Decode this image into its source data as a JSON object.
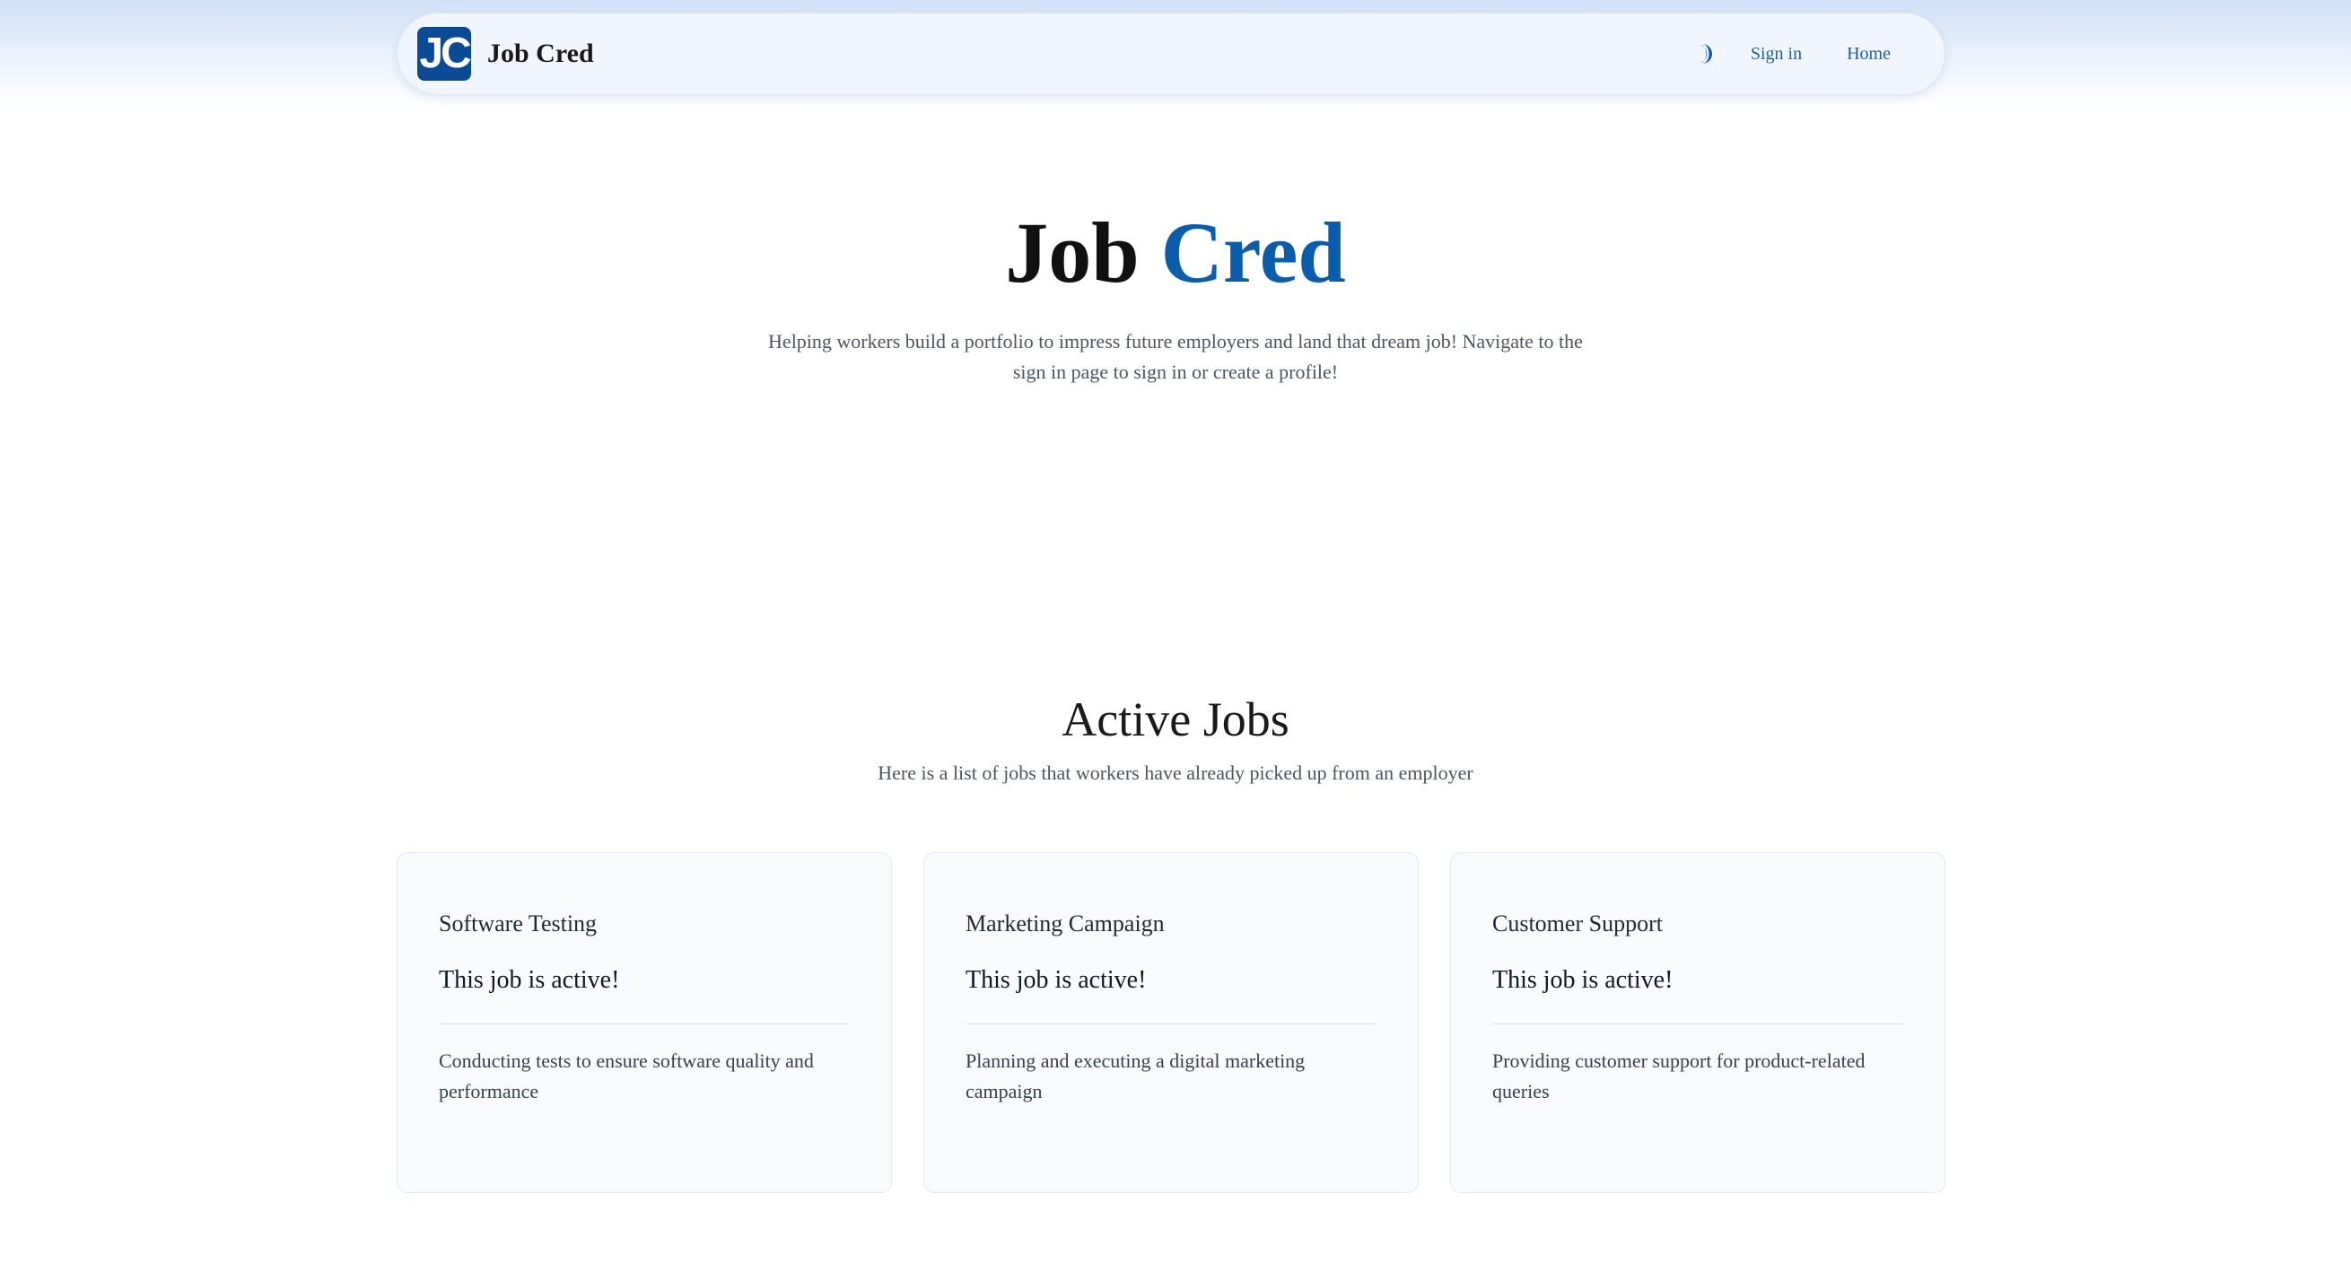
{
  "header": {
    "logo_text": "JC",
    "brand_name": "Job Cred",
    "theme_toggle_icon": "half-moon-icon",
    "nav_links": [
      {
        "label": "Sign in"
      },
      {
        "label": "Home"
      }
    ]
  },
  "hero": {
    "title_part1": "Job",
    "title_part2": "Cred",
    "description": "Helping workers build a portfolio to impress future employers and land that dream job! Navigate to the sign in page to sign in or create a profile!"
  },
  "active_jobs": {
    "title": "Active Jobs",
    "subtitle": "Here is a list of jobs that workers have already picked up from an employer",
    "jobs": [
      {
        "title": "Software Testing",
        "status": "This job is active!",
        "description": "Conducting tests to ensure software quality and performance"
      },
      {
        "title": "Marketing Campaign",
        "status": "This job is active!",
        "description": "Planning and executing a digital marketing campaign"
      },
      {
        "title": "Customer Support",
        "status": "This job is active!",
        "description": "Providing customer support for product-related queries"
      }
    ]
  },
  "colors": {
    "brand_blue": "#0b4a94",
    "accent_blue": "#0b5cab",
    "link_blue": "#1d5fa6"
  }
}
